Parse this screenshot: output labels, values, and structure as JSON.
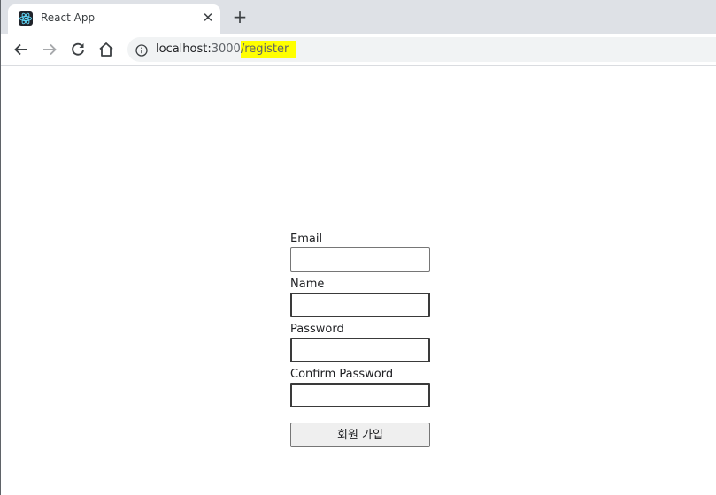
{
  "browser": {
    "tab": {
      "title": "React App",
      "favicon": "react-logo-icon",
      "close_icon": "close-icon"
    },
    "new_tab_icon": "plus-icon",
    "toolbar": {
      "back_icon": "arrow-left-icon",
      "forward_icon": "arrow-right-icon",
      "reload_icon": "reload-icon",
      "home_icon": "home-icon",
      "info_icon": "info-icon"
    },
    "url": {
      "host": "localhost:",
      "port": "3000",
      "path": "/register",
      "highlight_color": "#ffff00"
    }
  },
  "form": {
    "email_label": "Email",
    "email_value": "",
    "name_label": "Name",
    "name_value": "",
    "password_label": "Password",
    "password_value": "",
    "confirm_password_label": "Confirm Password",
    "confirm_password_value": "",
    "submit_label": "회원 가입"
  }
}
